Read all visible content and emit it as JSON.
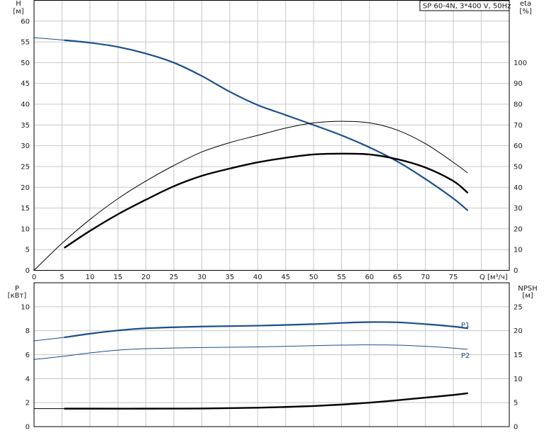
{
  "title": "SP 60-4N, 3*400 V, 50Hz",
  "colors": {
    "blue": "#1b4f8a",
    "black": "#000000",
    "thin_blue": "#1b4f8a",
    "grid": "#c8c8c8"
  },
  "chart_data": [
    {
      "type": "line",
      "panel": "top",
      "left_axis_label": [
        "H",
        "[м]"
      ],
      "right_axis_label": [
        "eta",
        "[%]"
      ],
      "xlabel": "Q [м³/ч]",
      "xlim": [
        0,
        85
      ],
      "ylim": [
        0,
        65
      ],
      "y2lim": [
        0,
        130
      ],
      "x_ticks": [
        0,
        5,
        10,
        15,
        20,
        25,
        30,
        35,
        40,
        45,
        50,
        55,
        60,
        65,
        70,
        75
      ],
      "y_ticks": [
        0,
        5,
        10,
        15,
        20,
        25,
        30,
        35,
        40,
        45,
        50,
        55,
        60
      ],
      "y2_ticks": [
        0,
        10,
        20,
        30,
        40,
        50,
        60,
        70,
        80,
        90,
        100
      ],
      "grid": true,
      "series": [
        {
          "axis": "left",
          "style": "thin-blue",
          "x": [
            0,
            2,
            4,
            5.5
          ],
          "y": [
            56,
            55.8,
            55.6,
            55.4
          ]
        },
        {
          "axis": "left",
          "style": "bold-blue",
          "x": [
            5.5,
            10,
            15,
            20,
            25,
            30,
            35,
            40,
            45,
            50,
            55,
            60,
            65,
            70,
            75,
            77.5
          ],
          "y": [
            55.4,
            54.8,
            53.8,
            52.2,
            50.0,
            46.8,
            43.0,
            39.8,
            37.4,
            35.0,
            32.5,
            29.6,
            26.2,
            22.0,
            17.3,
            14.5
          ]
        },
        {
          "axis": "right",
          "style": "thin-black",
          "x": [
            0,
            5,
            10,
            15,
            20,
            25,
            30,
            35,
            40,
            45,
            50,
            55,
            60,
            65,
            70,
            75,
            77.5
          ],
          "y": [
            0,
            13,
            24.5,
            34.5,
            43,
            50.5,
            57,
            61.5,
            65,
            68.5,
            71,
            71.8,
            71,
            67.5,
            61,
            52,
            47
          ]
        },
        {
          "axis": "right",
          "style": "bold-black",
          "x": [
            5.5,
            10,
            15,
            20,
            25,
            30,
            35,
            40,
            45,
            50,
            55,
            60,
            65,
            70,
            75,
            77.5
          ],
          "y": [
            11,
            19,
            27,
            34,
            40.5,
            45.5,
            49,
            52,
            54.2,
            55.8,
            56.2,
            55.8,
            53.5,
            49.5,
            43,
            37.5
          ]
        }
      ]
    },
    {
      "type": "line",
      "panel": "bottom",
      "left_axis_label": [
        "P",
        "[кВт]"
      ],
      "right_axis_label": [
        "NPSH",
        "[м]"
      ],
      "xlim": [
        0,
        85
      ],
      "ylim": [
        0,
        12
      ],
      "y2lim": [
        0,
        30
      ],
      "y_ticks": [
        0,
        2,
        4,
        6,
        8,
        10
      ],
      "y2_ticks": [
        0,
        5,
        10,
        15,
        20,
        25
      ],
      "grid": true,
      "series": [
        {
          "name": "P1",
          "axis": "left",
          "style": "bold-blue",
          "x": [
            5.5,
            10,
            15,
            20,
            30,
            40,
            50,
            55,
            60,
            65,
            70,
            75,
            77.5
          ],
          "y": [
            7.45,
            7.75,
            8.02,
            8.2,
            8.35,
            8.42,
            8.55,
            8.65,
            8.72,
            8.7,
            8.55,
            8.35,
            8.2
          ]
        },
        {
          "axis": "left",
          "style": "thin-blue",
          "x": [
            0,
            5.5
          ],
          "y": [
            7.15,
            7.45
          ]
        },
        {
          "name": "P2",
          "axis": "left",
          "style": "thin-blue",
          "x": [
            0,
            5,
            10,
            15,
            20,
            30,
            40,
            50,
            55,
            60,
            65,
            70,
            75,
            77.5
          ],
          "y": [
            5.6,
            5.85,
            6.15,
            6.38,
            6.5,
            6.6,
            6.65,
            6.75,
            6.8,
            6.82,
            6.8,
            6.7,
            6.55,
            6.45
          ]
        },
        {
          "name": "NPSH",
          "axis": "right",
          "style": "bold-black",
          "x": [
            5.5,
            10,
            20,
            30,
            40,
            45,
            50,
            55,
            60,
            65,
            70,
            75,
            77.5
          ],
          "y": [
            3.75,
            3.75,
            3.75,
            3.78,
            3.95,
            4.1,
            4.3,
            4.6,
            5.0,
            5.5,
            6.05,
            6.6,
            6.95
          ]
        },
        {
          "axis": "right",
          "style": "thin-black",
          "x": [
            0,
            5.5
          ],
          "y": [
            3.75,
            3.75
          ]
        }
      ]
    }
  ]
}
